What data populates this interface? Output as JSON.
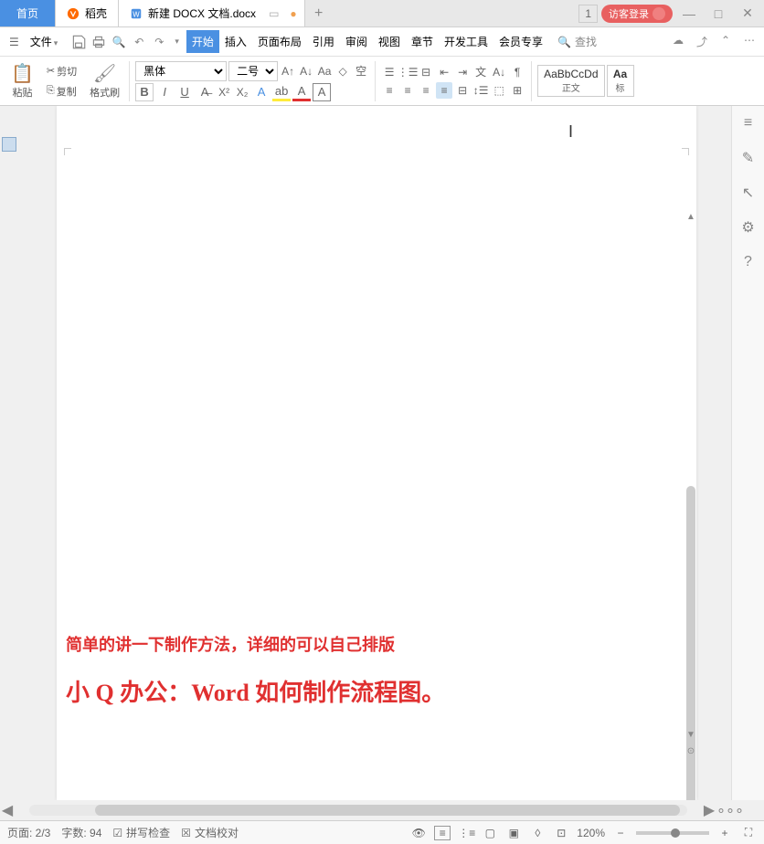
{
  "tabs": {
    "home": "首页",
    "dk": "稻壳",
    "doc": "新建 DOCX 文档.docx",
    "add": "+",
    "counter": "1",
    "login": "访客登录"
  },
  "menu": {
    "file": "文件",
    "tabs": [
      "开始",
      "插入",
      "页面布局",
      "引用",
      "审阅",
      "视图",
      "章节",
      "开发工具",
      "会员专享"
    ],
    "search": "查找"
  },
  "ribbon": {
    "paste": "粘贴",
    "cut": "剪切",
    "copy": "复制",
    "format_painter": "格式刷",
    "font_name": "黑体",
    "font_size": "二号",
    "style_normal_preview": "AaBbCcDd",
    "style_normal_name": "正文",
    "style_heading_preview": "Aa",
    "style_heading_name": "标"
  },
  "document": {
    "line1": "简单的讲一下制作方法，详细的可以自己排版",
    "line2": "小 Q 办公：Word 如何制作流程图。"
  },
  "status": {
    "page": "页面: 2/3",
    "words": "字数: 94",
    "spell": "拼写检查",
    "proof": "文档校对",
    "zoom": "120%"
  }
}
